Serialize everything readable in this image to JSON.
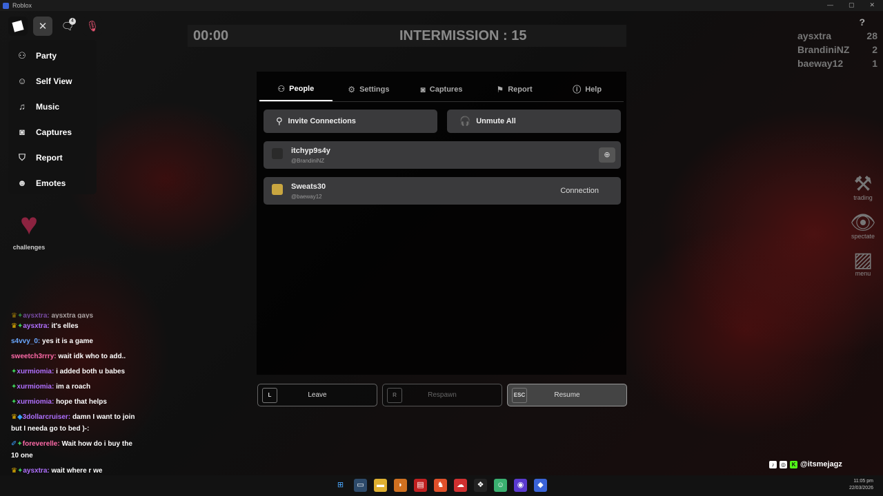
{
  "window": {
    "title": "Roblox"
  },
  "topbar": {
    "notification_count": "4"
  },
  "side_menu": {
    "items": [
      {
        "label": "Party",
        "icon": "party-icon"
      },
      {
        "label": "Self View",
        "icon": "self-view-icon"
      },
      {
        "label": "Music",
        "icon": "music-icon"
      },
      {
        "label": "Captures",
        "icon": "camera-icon"
      },
      {
        "label": "Report",
        "icon": "shield-icon"
      },
      {
        "label": "Emotes",
        "icon": "emote-icon"
      }
    ]
  },
  "challenges": {
    "label": "challenges"
  },
  "hud": {
    "timer": "00:00",
    "intermission": "INTERMISSION : 15",
    "help": "?"
  },
  "leaderboard": [
    {
      "name": "aysxtra",
      "score": "28"
    },
    {
      "name": "BrandiniNZ",
      "score": "2"
    },
    {
      "name": "baeway12",
      "score": "1"
    }
  ],
  "right_tools": [
    {
      "label": "trading",
      "icon": "hammer-icon"
    },
    {
      "label": "spectate",
      "icon": "eye-icon"
    },
    {
      "label": "menu",
      "icon": "menu-icon"
    }
  ],
  "tabs": [
    {
      "label": "People",
      "active": true
    },
    {
      "label": "Settings",
      "active": false
    },
    {
      "label": "Captures",
      "active": false
    },
    {
      "label": "Report",
      "active": false
    },
    {
      "label": "Help",
      "active": false
    }
  ],
  "actions": {
    "invite": "Invite Connections",
    "unmute": "Unmute All"
  },
  "players": [
    {
      "name": "itchyp9s4y",
      "username": "@BrandiniNZ"
    },
    {
      "name": "Sweats30",
      "username": "@baeway12",
      "status": "Connection"
    }
  ],
  "bottom_buttons": {
    "leave": {
      "key": "L",
      "label": "Leave"
    },
    "respawn": {
      "key": "R",
      "label": "Respawn"
    },
    "resume": {
      "key": "ESC",
      "label": "Resume"
    }
  },
  "chat": [
    {
      "user": "aysxtra:",
      "text": "aysxtra gays",
      "color": "#b070ff"
    },
    {
      "user": "aysxtra:",
      "text": "it's elles",
      "color": "#b070ff"
    },
    {
      "user": "s4vvy_0:",
      "text": "yes it is a game",
      "color": "#6aa8ff"
    },
    {
      "user": "sweetch3rrry:",
      "text": "wait idk who to add..",
      "color": "#ff6aa8"
    },
    {
      "user": "xurmiomia:",
      "text": "i added both u babes",
      "color": "#b070ff"
    },
    {
      "user": "xurmiomia:",
      "text": "im a roach",
      "color": "#b070ff"
    },
    {
      "user": "xurmiomia:",
      "text": "hope that helps",
      "color": "#b070ff"
    },
    {
      "user": "3dollarcruiser:",
      "text": "damn I want to join but I needa go to bed )-:",
      "color": "#b070ff"
    },
    {
      "user": "foreverelle:",
      "text": "Wait how do i buy the 10 one",
      "color": "#ff6aa8"
    },
    {
      "user": "aysxtra:",
      "text": "wait where r we",
      "color": "#b070ff"
    }
  ],
  "stream_handle": "@itsmejagz",
  "clock": {
    "time": "11:05 pm",
    "date": "22/03/2026"
  }
}
